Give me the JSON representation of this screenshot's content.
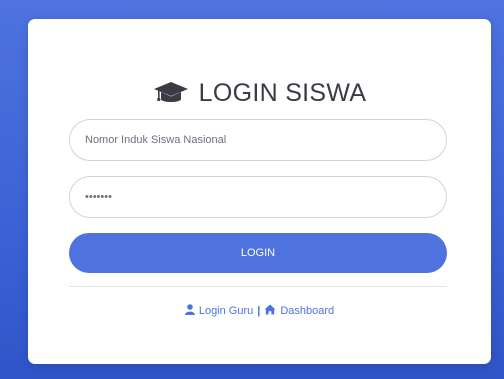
{
  "colors": {
    "background": "#4e73df",
    "card": "#ffffff",
    "primary": "#4e73df",
    "title_text": "#3a3b45",
    "input_border": "#d1d3e2"
  },
  "header": {
    "icon": "graduation-cap-icon",
    "title": "LOGIN SISWA"
  },
  "form": {
    "nisn_placeholder": "Nomor Induk Siswa Nasional",
    "nisn_value": "",
    "password_placeholder": "",
    "password_value": "•••••••",
    "login_label": "LOGIN"
  },
  "footer": {
    "guru_icon": "user-icon",
    "guru_label": "Login Guru",
    "separator": "|",
    "dashboard_icon": "home-icon",
    "dashboard_label": "Dashboard"
  }
}
